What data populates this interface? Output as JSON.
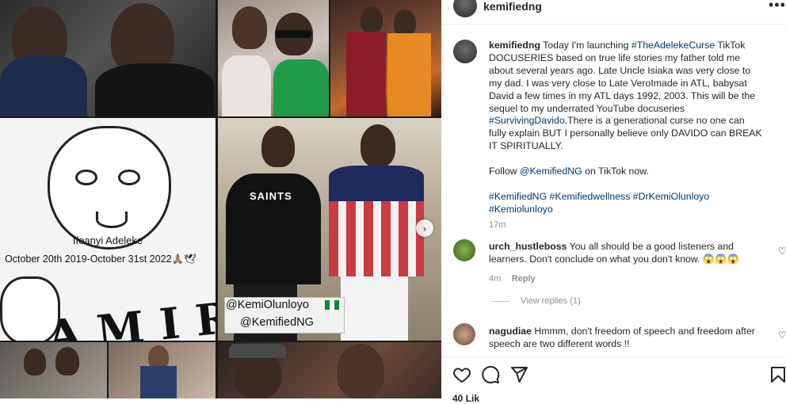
{
  "header": {
    "username": "kemifiedng",
    "more_label": "•••"
  },
  "media": {
    "memorial_name": "Ifeanyi Adeleke",
    "memorial_dates": "October 20th 2019-October 31st 2022🙏🏽🕊",
    "amiri_text": "AMIRI",
    "tag_line_1": "@KemiOlunloyo",
    "tag_line_2": "@KemifiedNG",
    "shirt_text": "SAINTS",
    "next_icon": "chevron-right-icon"
  },
  "caption": {
    "username": "kemifiedng",
    "text_1": "Today I'm launching",
    "hashtag_1": "#TheAdelekeCurse",
    "text_2": "TikTok DOCUSERIES based on true life stories my father told me about several years ago. Late Uncle Isiaka was very close to my dad. I was very close to Late VeroImade in ATL, babysat David a few times in my ATL days 1992, 2003. This will be the sequel to my underrated YouTube docuseries",
    "hashtag_2": "#SurvivingDavido",
    "text_3": ".There is a generational curse no one can fully explain BUT I personally believe only DAVIDO can BREAK IT SPIRITUALLY.",
    "follow_text": "Follow",
    "follow_handle": "@KemifiedNG",
    "follow_suffix": "on TikTok now.",
    "tags": "#KemifiedNG #Kemifiedwellness #DrKemiOlunloyo #Kemiolunloyo",
    "time": "17m"
  },
  "comments": [
    {
      "username": "urch_hustleboss",
      "text": "You all should be a good listeners and learners. Don't conclude on what you don't know. 😱😱😱",
      "time": "4m",
      "reply_label": "Reply",
      "view_replies": "View replies (1)"
    },
    {
      "username": "nagudiae",
      "text": "Hmmm, don't freedom of speech and freedom after speech are two different words !!"
    }
  ],
  "actions": {
    "like_icon": "heart-icon",
    "comment_icon": "comment-icon",
    "share_icon": "send-icon",
    "save_icon": "bookmark-icon"
  },
  "likes_partial": "40 Lik",
  "colors": {
    "link": "#00376b",
    "muted": "#8e8e8e",
    "text": "#262626"
  }
}
